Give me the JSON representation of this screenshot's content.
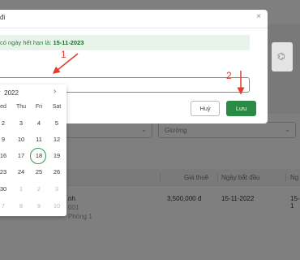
{
  "modal": {
    "title_partial": "đi",
    "close_icon": "×",
    "notice_prefix": "có ngày hết hạn là: ",
    "notice_date": "15-11-2023",
    "cancel_label": "Huỷ",
    "save_label": "Lưu",
    "side_icon": "tag-icon"
  },
  "datepicker": {
    "month_partial": "r",
    "year": "2022",
    "weekdays": [
      "ed",
      "Thu",
      "Fri",
      "Sat"
    ],
    "rows": [
      [
        "2",
        "3",
        "4",
        "5"
      ],
      [
        "9",
        "10",
        "11",
        "12"
      ],
      [
        "16",
        "17",
        "18",
        "19"
      ],
      [
        "23",
        "24",
        "25",
        "26"
      ],
      [
        "30",
        "1",
        "2",
        "3"
      ],
      [
        "7",
        "8",
        "9",
        "10"
      ]
    ],
    "selected_day": "18"
  },
  "background": {
    "filter_bed": "Giường",
    "columns": {
      "price": "Giá thuê",
      "start_date": "Ngày bắt đầu",
      "partial": "Ng"
    },
    "row": {
      "name_partial": "nh",
      "code_partial": "001",
      "note_partial": "Phòng 1",
      "price": "3,500,000 đ",
      "start_date": "15-11-2022",
      "partial": "15-1"
    }
  },
  "annotations": {
    "step1": "1",
    "step2": "2"
  },
  "colors": {
    "primary": "#2b8a45",
    "annotation": "#e23b2a",
    "notice_bg": "#e8f4ea"
  }
}
